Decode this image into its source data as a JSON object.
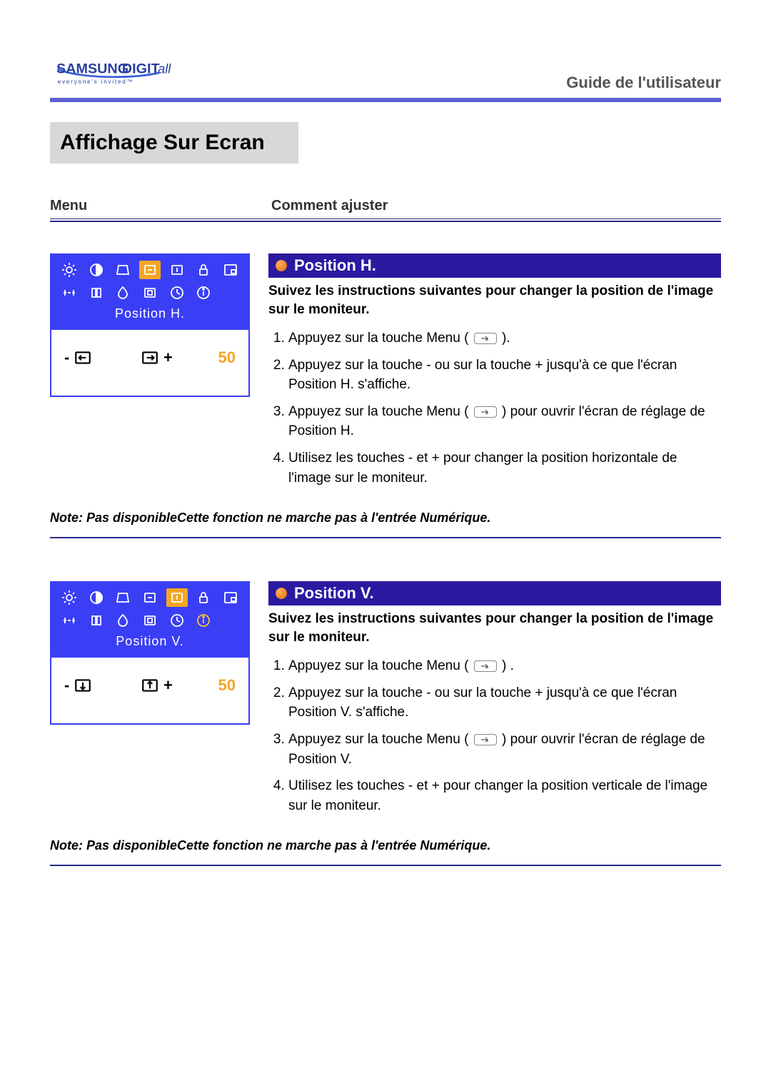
{
  "header": {
    "brand_main": "SAMSUNG",
    "brand_sub": "DIGITall",
    "brand_tagline": "everyone's invited™",
    "guide_title": "Guide de l'utilisateur"
  },
  "page_title": "Affichage Sur Ecran",
  "columns": {
    "menu": "Menu",
    "adjust": "Comment ajuster"
  },
  "sections": [
    {
      "osd_label": "Position H.",
      "osd_value": "50",
      "highlighted_icon_index": 3,
      "heading": "Position H.",
      "lead": "Suivez les instructions suivantes pour changer la position de l'image sur le moniteur.",
      "steps": [
        "Appuyez sur la touche Menu ( ⏎ ).",
        "Appuyez sur la touche - ou sur la touche + jusqu'à ce que l'écran Position H. s'affiche.",
        "Appuyez sur la touche Menu ( ⏎ ) pour ouvrir l'écran de réglage de Position H.",
        "Utilisez les touches - et + pour changer la position horizontale de l'image sur le moniteur."
      ],
      "note": "Note: Pas disponibleCette fonction ne marche pas à l'entrée Numérique.",
      "adj_icon": "h"
    },
    {
      "osd_label": "Position V.",
      "osd_value": "50",
      "highlighted_icon_index": 4,
      "heading": "Position V.",
      "lead": "Suivez les instructions suivantes pour changer la position de l'image sur le moniteur.",
      "steps": [
        "Appuyez sur la touche Menu ( ⏎ ) .",
        "Appuyez sur la touche - ou sur la touche + jusqu'à ce que l'écran Position V. s'affiche.",
        "Appuyez sur la touche Menu ( ⏎ ) pour ouvrir l'écran de réglage de Position V.",
        "Utilisez les touches - et + pour changer la position verticale de l'image sur le moniteur."
      ],
      "note": "Note: Pas disponibleCette fonction ne marche pas à l'entrée Numérique.",
      "adj_icon": "v"
    }
  ]
}
